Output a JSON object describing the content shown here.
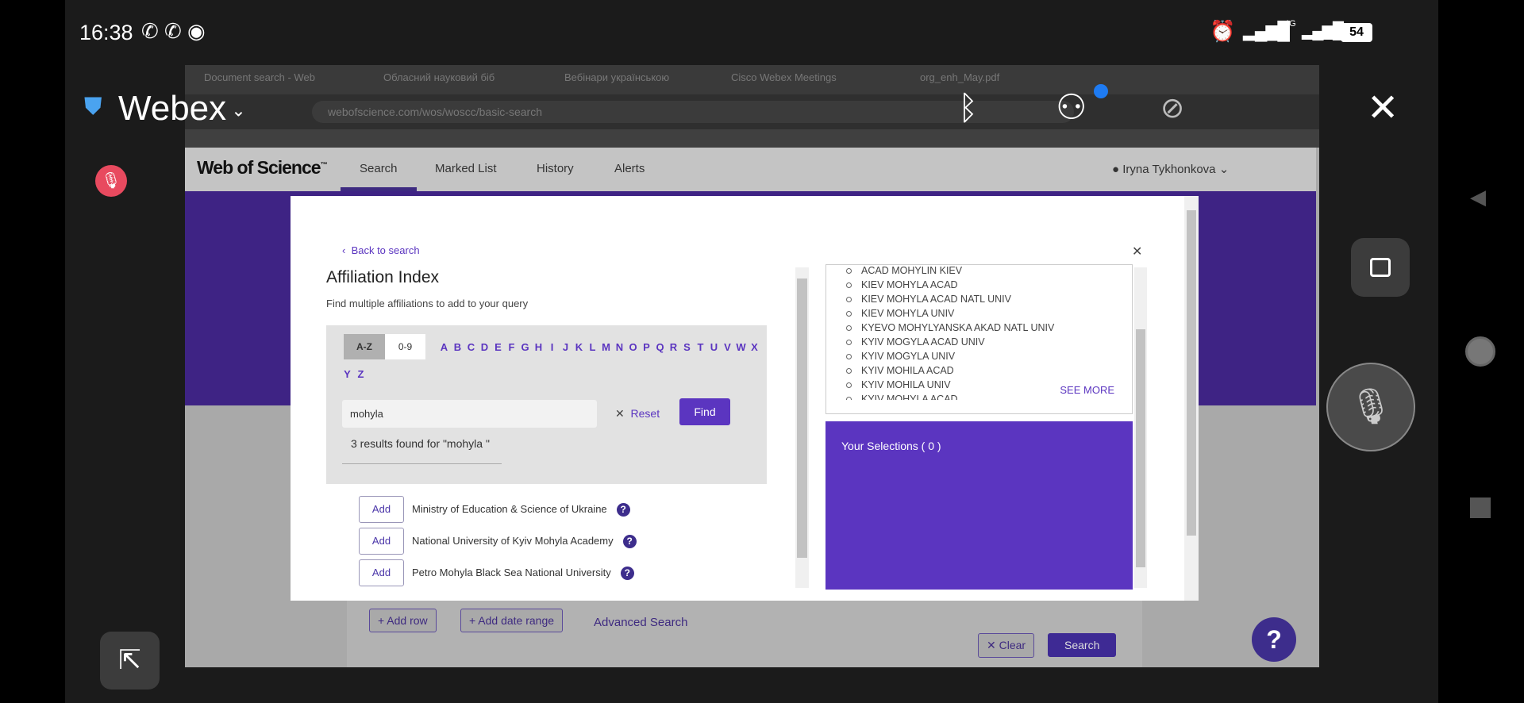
{
  "status_bar": {
    "time": "16:38",
    "battery": "54",
    "network": "4G"
  },
  "webex": {
    "title": "Webex"
  },
  "browser": {
    "tabs": [
      "Document search - Web",
      "Обласний науковий біб",
      "Вебінари українською",
      "Cisco Webex Meetings",
      "org_enh_May.pdf"
    ],
    "url": "webofscience.com/wos/woscc/basic-search"
  },
  "wos": {
    "brand": "Web of Science",
    "tm": "™",
    "nav": [
      "Search",
      "Marked List",
      "History",
      "Alerts"
    ],
    "user": "Iryna Tykhonkova"
  },
  "page": {
    "add_row": "Add row",
    "add_date_range": "Add date range",
    "advanced_search": "Advanced Search",
    "clear": "Clear",
    "search": "Search"
  },
  "modal": {
    "back": "Back to search",
    "title": "Affiliation Index",
    "subtitle": "Find multiple affiliations to add to your query",
    "az": "A-Z",
    "num": "0-9",
    "letters": [
      "A",
      "B",
      "C",
      "D",
      "E",
      "F",
      "G",
      "H",
      "I",
      "J",
      "K",
      "L",
      "M",
      "N",
      "O",
      "P",
      "Q",
      "R",
      "S",
      "T",
      "U",
      "V",
      "W",
      "X",
      "Y",
      "Z"
    ],
    "search_value": "mohyla",
    "reset": "Reset",
    "find": "Find",
    "results_text": "3 results found for \"mohyla \"",
    "add_label": "Add",
    "results": [
      "Ministry of Education & Science of Ukraine",
      "National University of Kyiv Mohyla Academy",
      "Petro Mohyla Black Sea National University"
    ],
    "variants": [
      "ACAD MOHYLIN KIEV",
      "KIEV MOHYLA ACAD",
      "KIEV MOHYLA ACAD NATL UNIV",
      "KIEV MOHYLA UNIV",
      "KYEVO MOHYLYANSKA AKAD NATL UNIV",
      "KYIV MOGYLA ACAD UNIV",
      "KYIV MOGYLA UNIV",
      "KYIV MOHILA ACAD",
      "KYIV MOHILA UNIV",
      "KYIV MOHYLA ACAD"
    ],
    "see_more": "SEE MORE",
    "selections": "Your Selections ( 0 )",
    "help": "?"
  },
  "colors": {
    "accent": "#5b35c0"
  }
}
